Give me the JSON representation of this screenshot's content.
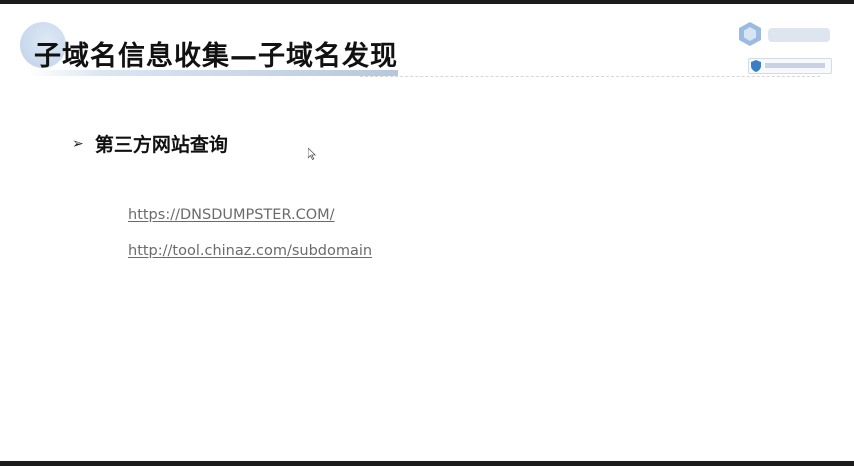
{
  "slide": {
    "title": "子域名信息收集—子域名发现",
    "bullet": {
      "arrow": "➢",
      "text": "第三方网站查询"
    },
    "links": [
      "https://DNSDUMPSTER.COM/",
      "http://tool.chinaz.com/subdomain"
    ]
  },
  "logo": {
    "icon": "company-logo-icon",
    "badge_icon": "shield-icon"
  },
  "colors": {
    "title_text": "#111111",
    "link_text": "#6b6b6b",
    "accent_circle": "#c8d8ec",
    "logo_blue": "#3a7fc4"
  }
}
